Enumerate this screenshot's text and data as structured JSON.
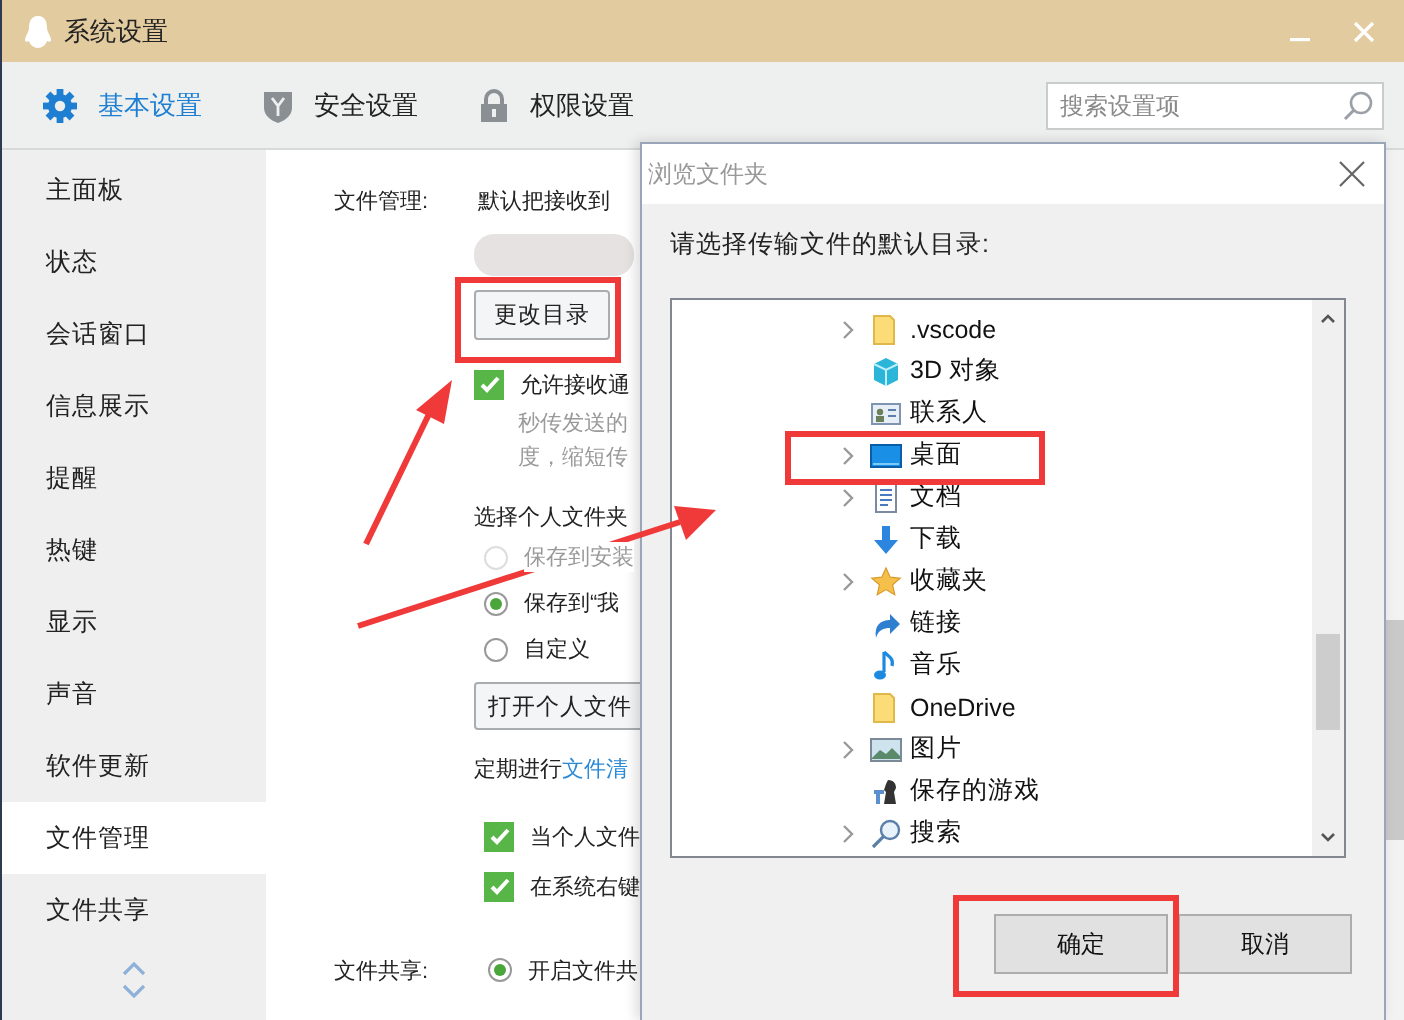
{
  "window": {
    "title": "系统设置"
  },
  "tabs": [
    {
      "label": "基本设置",
      "selected": true,
      "kind": "gear"
    },
    {
      "label": "安全设置",
      "selected": false,
      "kind": "shield"
    },
    {
      "label": "权限设置",
      "selected": false,
      "kind": "lock"
    }
  ],
  "search": {
    "placeholder": "搜索设置项"
  },
  "sidebar": {
    "items": [
      {
        "label": "主面板",
        "selected": false
      },
      {
        "label": "状态",
        "selected": false
      },
      {
        "label": "会话窗口",
        "selected": false
      },
      {
        "label": "信息展示",
        "selected": false
      },
      {
        "label": "提醒",
        "selected": false
      },
      {
        "label": "热键",
        "selected": false
      },
      {
        "label": "显示",
        "selected": false
      },
      {
        "label": "声音",
        "selected": false
      },
      {
        "label": "软件更新",
        "selected": false
      },
      {
        "label": "文件管理",
        "selected": true
      },
      {
        "label": "文件共享",
        "selected": false
      }
    ]
  },
  "file_management": {
    "label": "文件管理:",
    "description": "默认把接收到",
    "change_button": "更改目录",
    "allow_option": {
      "label": "允许接收通",
      "checked": true
    },
    "note_lines": [
      "秒传发送的",
      "度，缩短传"
    ],
    "folder_heading": "选择个人文件夹",
    "folder_options": [
      {
        "label": "保存到安装",
        "selected": false,
        "disabled": true
      },
      {
        "label": "保存到“我",
        "selected": true,
        "disabled": false
      },
      {
        "label": "自定义",
        "selected": false,
        "disabled": false
      }
    ],
    "open_button": "打开个人文件",
    "cleanup": {
      "text": "定期进行",
      "link": "文件清"
    },
    "checks": [
      {
        "label": "当个人文件",
        "checked": true
      },
      {
        "label": "在系统右键",
        "checked": true
      }
    ]
  },
  "file_sharing": {
    "label": "文件共享:",
    "options": [
      {
        "label": "开启文件共",
        "selected": true
      }
    ]
  },
  "dialog": {
    "title": "浏览文件夹",
    "prompt": "请选择传输文件的默认目录:",
    "tree": [
      {
        "label": ".vscode",
        "kind": "folder",
        "expandable": true
      },
      {
        "label": "3D 对象",
        "kind": "cube",
        "expandable": false
      },
      {
        "label": "联系人",
        "kind": "contacts",
        "expandable": false
      },
      {
        "label": "桌面",
        "kind": "desktop",
        "expandable": true
      },
      {
        "label": "文档",
        "kind": "document",
        "expandable": true
      },
      {
        "label": "下载",
        "kind": "download",
        "expandable": false
      },
      {
        "label": "收藏夹",
        "kind": "star",
        "expandable": true
      },
      {
        "label": "链接",
        "kind": "link",
        "expandable": false
      },
      {
        "label": "音乐",
        "kind": "music",
        "expandable": false
      },
      {
        "label": "OneDrive",
        "kind": "folder",
        "expandable": false
      },
      {
        "label": "图片",
        "kind": "pictures",
        "expandable": true
      },
      {
        "label": "保存的游戏",
        "kind": "games",
        "expandable": false
      },
      {
        "label": "搜索",
        "kind": "search",
        "expandable": true
      }
    ],
    "buttons": [
      "确定",
      "取消"
    ]
  }
}
